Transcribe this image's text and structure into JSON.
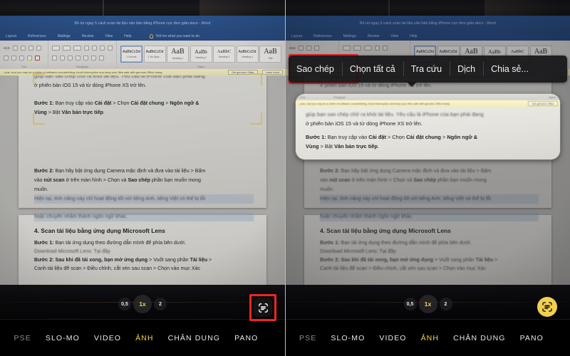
{
  "meta": {
    "left_caption": "iPhone camera viewfinder with Live Text button inactive",
    "right_caption": "iPhone camera viewfinder with Live Text active and text action menu shown"
  },
  "word": {
    "title": "Bỏ túi ngay 5 cách scan tài liệu văn bản bằng iPhone cực đơn giản.docx  -  Word",
    "ribbon_tabs": [
      "Layout",
      "References",
      "Mailings",
      "Review",
      "View",
      "Help"
    ],
    "tell_me": "Tell me what you want to do",
    "font_size": "22,5",
    "group_labels": {
      "font": "Font",
      "paragraph": "Paragraph",
      "styles": "Styles"
    },
    "style_gallery": [
      {
        "sample": "AaBbCcDd",
        "name": "1 Normal"
      },
      {
        "sample": "AaBbCcDd",
        "name": "1 No Spac..."
      },
      {
        "sample": "AaB",
        "name": "Heading 1"
      },
      {
        "sample": "AaBb",
        "name": "Heading 2"
      },
      {
        "sample": "AaBbC",
        "name": "Heading 3"
      },
      {
        "sample": "AaBbCcDd",
        "name": "Heading 4"
      },
      {
        "sample": "AaB",
        "name": "Title"
      }
    ],
    "activation_banner": {
      "message": "...uine, and you may be a victim of software counterfeiting. Avoid interruption and keep your files safe with genuine Office today.",
      "primary_button": "Get genuine Office",
      "secondary_button": "Learn more"
    }
  },
  "document": {
    "para_intro_line1": "giúp bạn sao chép chữ ra khỏi tài liệu. Yêu cầu là iPhone của bạn phải đang",
    "para_intro_line2": "ở phiên bản iOS 15 và từ dòng iPhone XS trở lên.",
    "step1_label": "Bước 1:",
    "step1_a": " Bạn truy cập",
    "step1_b": " vào ",
    "step1_c": "Cài đặt",
    "step1_d": " > Chọn ",
    "step1_e": "Cài đặt chung",
    "step1_f": " > ",
    "step1_g": "Ngôn ngữ &",
    "step1_h": "Vùng",
    "step1_i": " > Bật ",
    "step1_j": "Văn bản trực tiếp",
    "step1_k": ".",
    "step2_label": "Bước 2:",
    "step2_line1": " Bạn hãy bật ứng dụng Camera mặc định và đưa vào tài liệu > Bấm",
    "step2_line2_a": "vào ",
    "step2_line2_b": "nút scan",
    "step2_line2_c": " ở trên màn hình > Chọn và ",
    "step2_line2_d": "Sao chép",
    "step2_line2_e": " phần bạn muốn mong",
    "step2_line3": "muốn.",
    "note_line1": "Hiện tại, tính năng này chỉ hoạt động tốt với tiếng Anh, tiếng Việt có thể bị lỗi",
    "note_line2": "hoặc chuyển nhầm thành ngôn ngữ khác.",
    "heading4": "4. Scan tài liệu bằng ứng dụng Microsoft Lens",
    "lens_step1_label": "Bước 1:",
    "lens_step1": " Bạn tải ứng dụng theo đường dẫn mình để phía bên dưới.",
    "lens_download": "Download Microsoft Lens: Tại đây",
    "lens_step2_label": "Bước 2:",
    "lens_step2_a": " Sau khi đã tải xong, bạn mở ứng dụng",
    "lens_step2_b": " > Vuốt sang phần ",
    "lens_step2_c": "Tài liệu",
    "lens_step2_d": " >",
    "lens_step2_line2": "Canh tài liệu để scan > Điều chỉnh, cắt xén sau scan > Chọn vào mục Xác"
  },
  "camera": {
    "zoom_levels": [
      {
        "label": "0,5",
        "active": false
      },
      {
        "label": "1x",
        "active": true
      },
      {
        "label": "2",
        "active": false
      }
    ],
    "modes": [
      {
        "label": "PSE",
        "active": false,
        "truncated": true
      },
      {
        "label": "SLO-MO",
        "active": false
      },
      {
        "label": "VIDEO",
        "active": false
      },
      {
        "label": "ẢNH",
        "active": true
      },
      {
        "label": "CHÂN DUNG",
        "active": false
      },
      {
        "label": "PANO",
        "active": false
      }
    ],
    "live_text_icon": "live-text-scan-icon"
  },
  "context_menu": {
    "items": [
      {
        "label": "Sao chép",
        "highlighted": true
      },
      {
        "label": "Chọn tất cả",
        "highlighted": false
      },
      {
        "label": "Tra cứu",
        "highlighted": false
      },
      {
        "label": "Dịch",
        "highlighted": false
      },
      {
        "label": "Chia sẻ...",
        "highlighted": false
      }
    ]
  },
  "annotations": {
    "highlight_color": "#ef2525",
    "accent_yellow": "#f2d04a",
    "frame_yellow": "#e7d27a"
  }
}
